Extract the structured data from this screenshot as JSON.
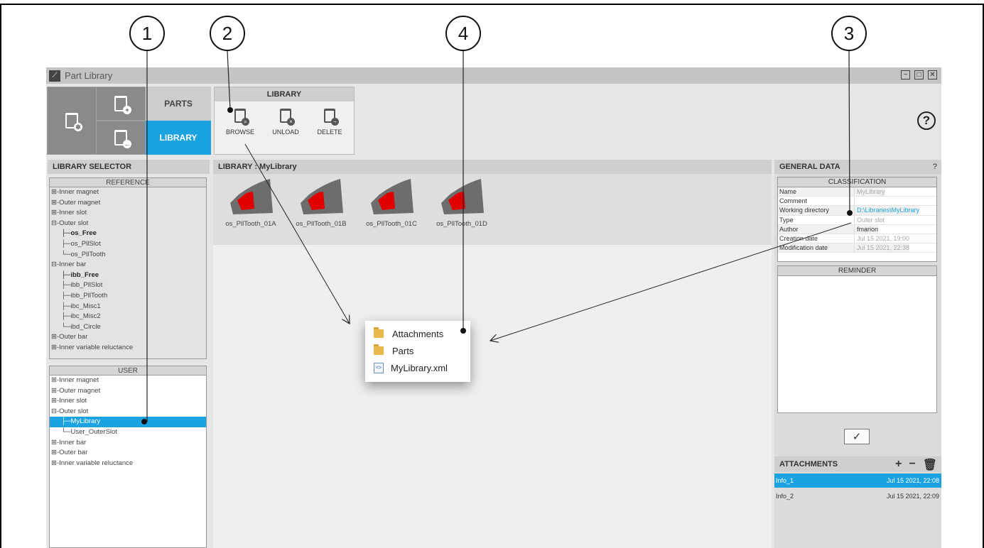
{
  "callouts": [
    "1",
    "2",
    "4",
    "3"
  ],
  "window": {
    "title": "Part Library",
    "buttons": [
      "−",
      "□",
      "✕"
    ]
  },
  "ribbon": {
    "tabs": {
      "parts": "PARTS",
      "library": "LIBRARY"
    },
    "group_title": "LIBRARY",
    "buttons": {
      "browse": "BROWSE",
      "unload": "UNLOAD",
      "delete": "DELETE"
    },
    "help": "?"
  },
  "library_selector": {
    "title": "LIBRARY SELECTOR",
    "reference": {
      "title": "REFERENCE",
      "items": [
        {
          "label": "Inner magnet",
          "prefix": "⊞-",
          "indent": 0,
          "bold": false
        },
        {
          "label": "Outer magnet",
          "prefix": "⊞-",
          "indent": 0,
          "bold": false
        },
        {
          "label": "Inner slot",
          "prefix": "⊞-",
          "indent": 0,
          "bold": false
        },
        {
          "label": "Outer slot",
          "prefix": "⊟-",
          "indent": 0,
          "bold": false
        },
        {
          "label": "os_Free",
          "prefix": "├─",
          "indent": 1,
          "bold": true
        },
        {
          "label": "os_PllSlot",
          "prefix": "├─",
          "indent": 1,
          "bold": false
        },
        {
          "label": "os_PllTooth",
          "prefix": "└─",
          "indent": 1,
          "bold": false
        },
        {
          "label": "Inner bar",
          "prefix": "⊟-",
          "indent": 0,
          "bold": false
        },
        {
          "label": "ibb_Free",
          "prefix": "├─",
          "indent": 1,
          "bold": true
        },
        {
          "label": "ibb_PllSlot",
          "prefix": "├─",
          "indent": 1,
          "bold": false
        },
        {
          "label": "ibb_PllTooth",
          "prefix": "├─",
          "indent": 1,
          "bold": false
        },
        {
          "label": "ibc_Misc1",
          "prefix": "├─",
          "indent": 1,
          "bold": false
        },
        {
          "label": "ibc_Misc2",
          "prefix": "├─",
          "indent": 1,
          "bold": false
        },
        {
          "label": "ibd_Circle",
          "prefix": "└─",
          "indent": 1,
          "bold": false
        },
        {
          "label": "Outer bar",
          "prefix": "⊞-",
          "indent": 0,
          "bold": false
        },
        {
          "label": "Inner variable reluctance",
          "prefix": "⊞-",
          "indent": 0,
          "bold": false
        }
      ]
    },
    "user": {
      "title": "USER",
      "items": [
        {
          "label": "Inner magnet",
          "prefix": "⊞-",
          "indent": 0,
          "selected": false
        },
        {
          "label": "Outer magnet",
          "prefix": "⊞-",
          "indent": 0,
          "selected": false
        },
        {
          "label": "Inner slot",
          "prefix": "⊞-",
          "indent": 0,
          "selected": false
        },
        {
          "label": "Outer slot",
          "prefix": "⊟-",
          "indent": 0,
          "selected": false
        },
        {
          "label": "MyLibrary",
          "prefix": "├─",
          "indent": 1,
          "selected": true
        },
        {
          "label": "User_OuterSlot",
          "prefix": "└─",
          "indent": 1,
          "selected": false
        },
        {
          "label": "Inner bar",
          "prefix": "⊞-",
          "indent": 0,
          "selected": false
        },
        {
          "label": "Outer bar",
          "prefix": "⊞-",
          "indent": 0,
          "selected": false
        },
        {
          "label": "Inner variable reluctance",
          "prefix": "⊞-",
          "indent": 0,
          "selected": false
        }
      ]
    }
  },
  "library_view": {
    "title": "LIBRARY : MyLibrary",
    "parts": [
      "os_PllTooth_01A",
      "os_PllTooth_01B",
      "os_PllTooth_01C",
      "os_PllTooth_01D"
    ]
  },
  "explorer_popup": {
    "items": [
      {
        "label": "Attachments",
        "icon": "folder-icon"
      },
      {
        "label": "Parts",
        "icon": "folder-icon"
      },
      {
        "label": "MyLibrary.xml",
        "icon": "xml-file-icon"
      }
    ]
  },
  "general_data": {
    "title": "GENERAL DATA",
    "help": "?",
    "classification_title": "CLASSIFICATION",
    "rows": [
      {
        "key": "Name",
        "value": "MyLibrary"
      },
      {
        "key": "Comment",
        "value": ""
      },
      {
        "key": "Working directory",
        "value": "D:\\Libraries\\MyLibrary"
      },
      {
        "key": "Type",
        "value": "Outer slot"
      },
      {
        "key": "Author",
        "value": "fmarion"
      },
      {
        "key": "Creation date",
        "value": "Jul 15 2021, 19:00"
      },
      {
        "key": "Modification date",
        "value": "Jul 15 2021, 22:38"
      }
    ],
    "reminder_title": "REMINDER",
    "ok": "✓"
  },
  "attachments": {
    "title": "ATTACHMENTS",
    "buttons": [
      "+",
      "−",
      "🗑"
    ],
    "rows": [
      {
        "name": "Info_1",
        "date": "Jul 15 2021, 22:08",
        "selected": true
      },
      {
        "name": "Info_2",
        "date": "Jul 15 2021, 22:09",
        "selected": false
      }
    ]
  },
  "colors": {
    "accent": "#1aa3e0",
    "part_shape": "#6d6d6d",
    "part_highlight": "#e00000"
  }
}
